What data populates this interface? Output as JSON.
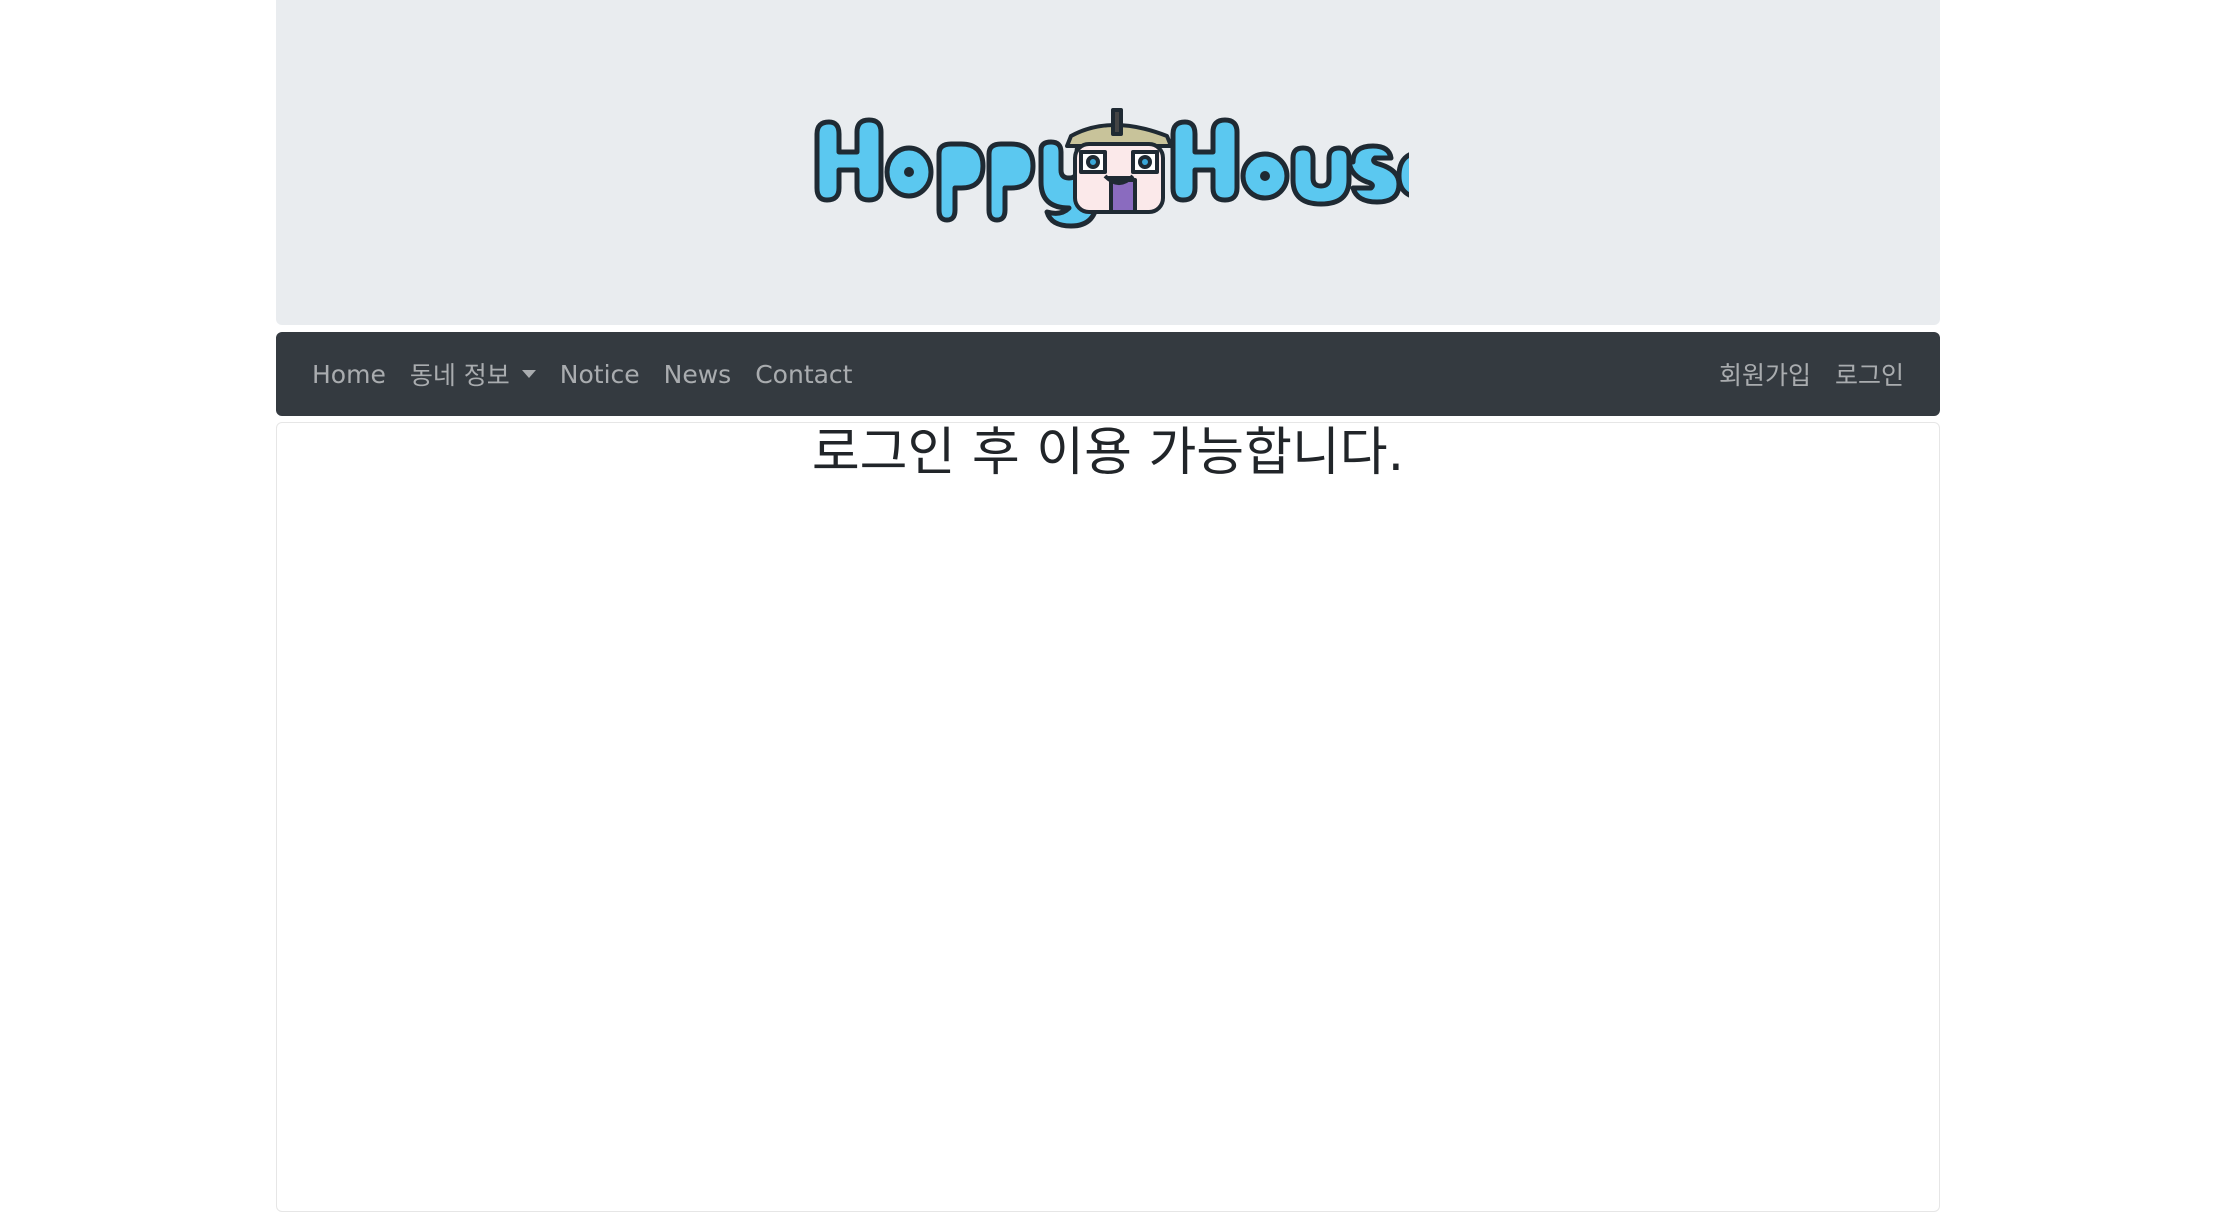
{
  "logo": {
    "text": "HappyHouse",
    "colors": {
      "fill": "#5bc8f0",
      "outline": "#1f2a33"
    }
  },
  "navbar": {
    "left_items": [
      {
        "label": "Home"
      },
      {
        "label": "동네 정보",
        "dropdown": true
      },
      {
        "label": "Notice"
      },
      {
        "label": "News"
      },
      {
        "label": "Contact"
      }
    ],
    "right_items": [
      {
        "label": "회원가입"
      },
      {
        "label": "로그인"
      }
    ],
    "background": "#343a40"
  },
  "main": {
    "message": "로그인 후 이용 가능합니다."
  },
  "colors": {
    "jumbotron_bg": "#e9ecef",
    "text": "#212529"
  }
}
